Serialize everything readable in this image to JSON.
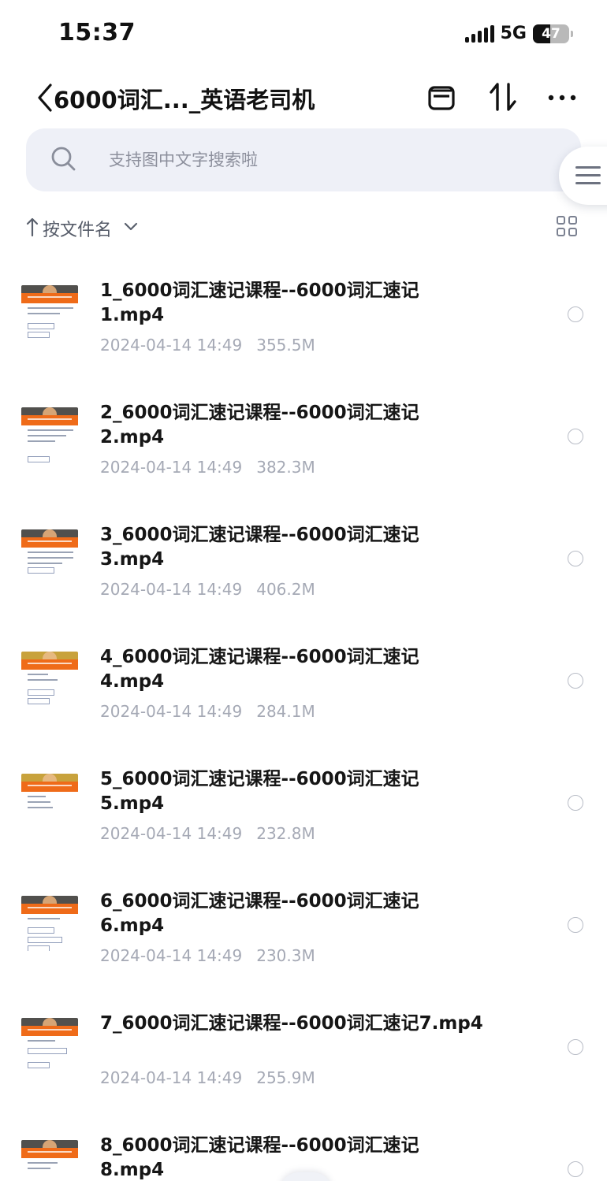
{
  "status_bar": {
    "time": "15:37",
    "network": "5G",
    "battery": "47"
  },
  "nav": {
    "back_icon": "chevron-left-icon",
    "title": "6000词汇..._英语老司机",
    "icons": [
      "box-icon",
      "sort-icon",
      "more-icon"
    ]
  },
  "search": {
    "placeholder": "支持图中文字搜索啦",
    "icon": "search-icon"
  },
  "side_menu": {
    "icon": "menu-icon"
  },
  "sort": {
    "label": "按文件名",
    "icon_sort": "arrow-up-icon",
    "icon_dropdown": "chevron-down-icon",
    "view_icon": "grid-view-icon"
  },
  "files": [
    {
      "name": "1_6000词汇速记课程--6000词汇速记1.mp4",
      "date": "2024-04-14 14:49",
      "size": "355.5M"
    },
    {
      "name": "2_6000词汇速记课程--6000词汇速记2.mp4",
      "date": "2024-04-14 14:49",
      "size": "382.3M"
    },
    {
      "name": "3_6000词汇速记课程--6000词汇速记3.mp4",
      "date": "2024-04-14 14:49",
      "size": "406.2M"
    },
    {
      "name": "4_6000词汇速记课程--6000词汇速记4.mp4",
      "date": "2024-04-14 14:49",
      "size": "284.1M"
    },
    {
      "name": "5_6000词汇速记课程--6000词汇速记5.mp4",
      "date": "2024-04-14 14:49",
      "size": "232.8M"
    },
    {
      "name": "6_6000词汇速记课程--6000词汇速记6.mp4",
      "date": "2024-04-14 14:49",
      "size": "230.3M"
    },
    {
      "name": "7_6000词汇速记课程--6000词汇速记7.mp4",
      "date": "2024-04-14 14:49",
      "size": "255.9M"
    },
    {
      "name": "8_6000词汇速记课程--6000词汇速记8.mp4",
      "date": "",
      "size": ""
    }
  ]
}
